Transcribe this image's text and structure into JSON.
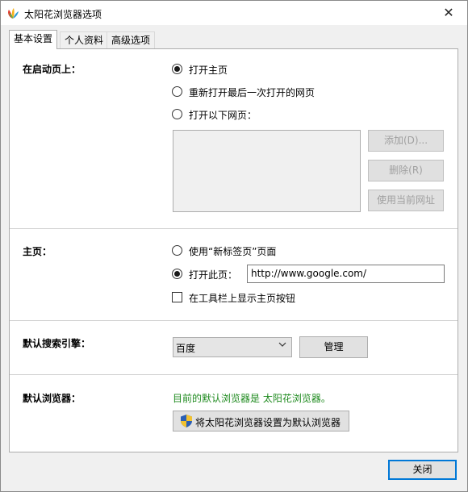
{
  "window": {
    "title": "太阳花浏览器选项",
    "close_glyph": "✕",
    "app_icon": "sunflower-logo-icon"
  },
  "tabs": [
    {
      "label": "基本设置",
      "active": true
    },
    {
      "label": "个人资料",
      "active": false
    },
    {
      "label": "高级选项",
      "active": false
    }
  ],
  "startup": {
    "label": "在启动页上：",
    "options": [
      {
        "label": "打开主页",
        "checked": true
      },
      {
        "label": "重新打开最后一次打开的网页",
        "checked": false
      },
      {
        "label": "打开以下网页：",
        "checked": false
      }
    ],
    "add_button": "添加(D)...",
    "remove_button": "删除(R)",
    "use_current_button": "使用当前网址"
  },
  "homepage": {
    "label": "主页：",
    "option_newtab": "使用“新标签页”页面",
    "option_open": "打开此页：",
    "url_value": "http://www.google.com/",
    "show_home_button": "在工具栏上显示主页按钮",
    "show_home_checked": false
  },
  "search": {
    "label": "默认搜索引擎：",
    "selected": "百度",
    "manage_button": "管理"
  },
  "default_browser": {
    "label": "默认浏览器：",
    "status": "目前的默认浏览器是 太阳花浏览器。",
    "set_button": "将太阳花浏览器设置为默认浏览器",
    "shield_icon": "uac-shield-icon"
  },
  "footer": {
    "close_button": "关闭"
  }
}
